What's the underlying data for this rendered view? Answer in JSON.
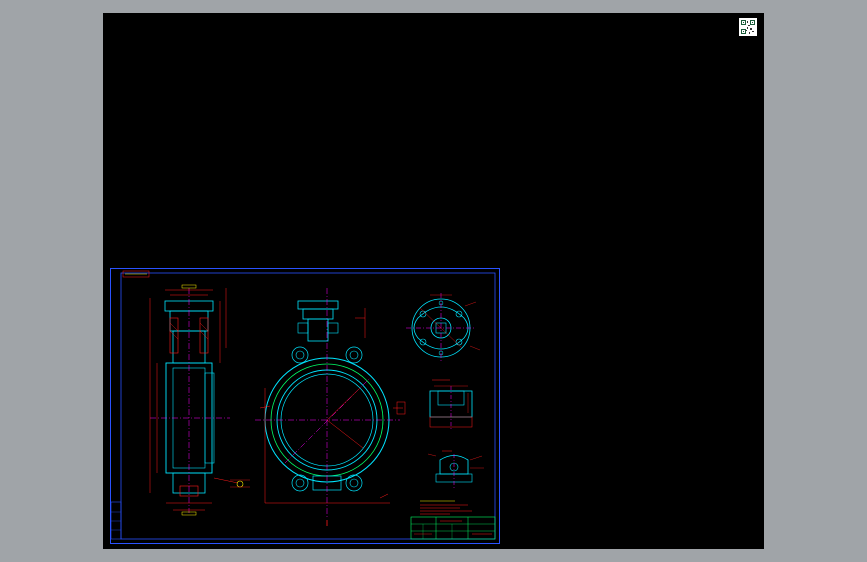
{
  "viewer": {
    "title": "",
    "background_color": "#000000",
    "outer_color": "#a0a4a8"
  },
  "drawing": {
    "frame_color": "#2a52ff",
    "geometry_color": "#00e5ff",
    "dimension_color": "#ff1a1a",
    "centerline_color": "#ff00ff",
    "title_block_color": "#00ff66",
    "icons": [
      "qr-code-icon"
    ]
  }
}
